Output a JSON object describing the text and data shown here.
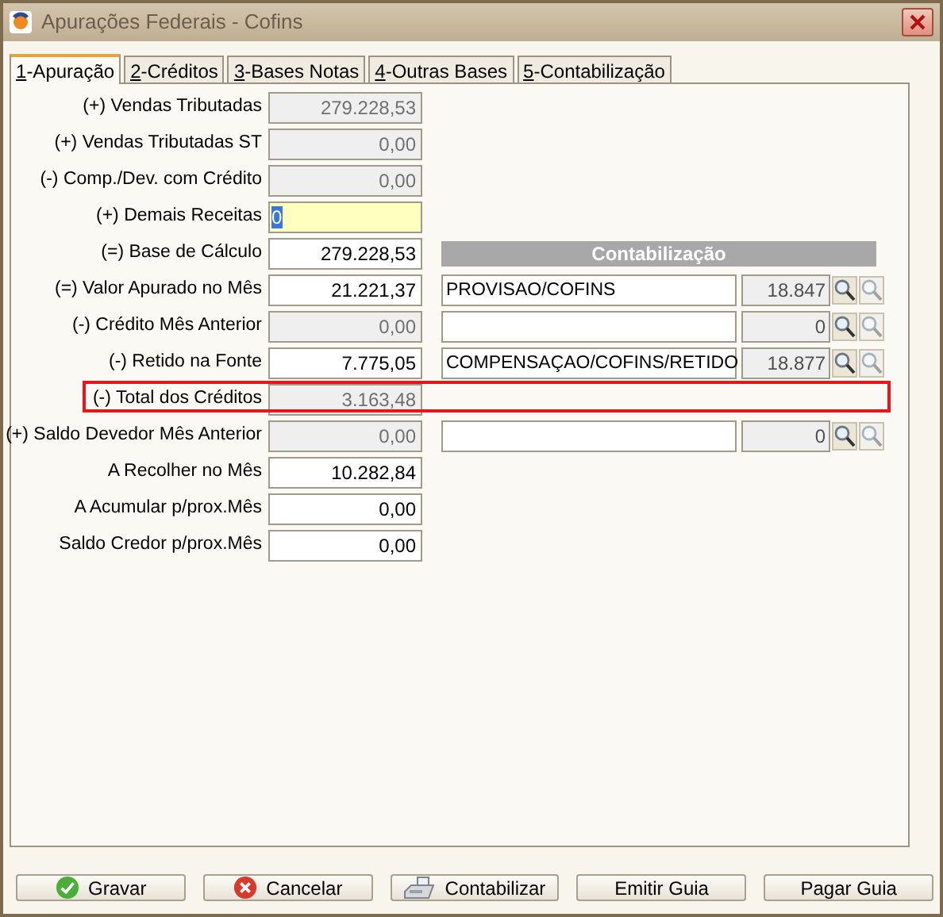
{
  "window": {
    "title": "Apurações Federais - Cofins"
  },
  "tabs": [
    {
      "label": "1-Apuração",
      "selected": true
    },
    {
      "label": "2-Créditos",
      "selected": false
    },
    {
      "label": "3-Bases Notas",
      "selected": false
    },
    {
      "label": "4-Outras Bases",
      "selected": false
    },
    {
      "label": "5-Contabilização",
      "selected": false
    }
  ],
  "rows": [
    {
      "label": "(+) Vendas Tributadas",
      "value": "279.228,53",
      "kind": "readonly",
      "highlighted": false
    },
    {
      "label": "(+) Vendas Tributadas ST",
      "value": "0,00",
      "kind": "readonly",
      "highlighted": false
    },
    {
      "label": "(-) Comp./Dev. com Crédito",
      "value": "0,00",
      "kind": "readonly",
      "highlighted": false
    },
    {
      "label": "(+) Demais Receitas",
      "value": "0",
      "kind": "focused",
      "highlighted": false
    },
    {
      "label": "(=) Base de Cálculo",
      "value": "279.228,53",
      "kind": "editable",
      "highlighted": false,
      "header": "Contabilização"
    },
    {
      "label": "(=) Valor Apurado no Mês",
      "value": "21.221,37",
      "kind": "editable",
      "highlighted": false,
      "account": {
        "name": "PROVISAO/COFINS",
        "code": "18.847"
      }
    },
    {
      "label": "(-) Crédito Mês Anterior",
      "value": "0,00",
      "kind": "readonly",
      "highlighted": false,
      "account": {
        "code": "0"
      }
    },
    {
      "label": "(-) Retido na Fonte",
      "value": "7.775,05",
      "kind": "editable",
      "highlighted": false,
      "account": {
        "name": "COMPENSAÇAO/COFINS/RETIDO",
        "code": "18.877"
      }
    },
    {
      "label": "(-) Total dos Créditos",
      "value": "3.163,48",
      "kind": "readonly",
      "highlighted": true
    },
    {
      "label": "(+) Saldo Devedor Mês Anterior",
      "value": "0,00",
      "kind": "readonly",
      "highlighted": false,
      "account": {
        "code": "0"
      }
    },
    {
      "label": "A Recolher no Mês",
      "value": "10.282,84",
      "kind": "editable",
      "highlighted": false
    },
    {
      "label": "A Acumular p/prox.Mês",
      "value": "0,00",
      "kind": "editable",
      "highlighted": false
    },
    {
      "label": "Saldo Credor p/prox.Mês",
      "value": "0,00",
      "kind": "editable",
      "highlighted": false
    }
  ],
  "buttons": [
    {
      "label": "Gravar",
      "kind": "save"
    },
    {
      "label": "Cancelar",
      "kind": "cancel"
    },
    {
      "label": "Contabilizar",
      "kind": "register"
    },
    {
      "label": "Emitir Guia",
      "kind": "plain"
    },
    {
      "label": "Pagar Guia",
      "kind": "plain"
    }
  ]
}
